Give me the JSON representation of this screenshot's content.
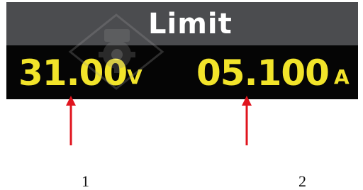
{
  "display": {
    "title": "Limit",
    "voltage": {
      "value": "31.00",
      "unit": "V"
    },
    "current": {
      "value": "05.100",
      "unit": "A"
    }
  },
  "callouts": [
    {
      "label": "1"
    },
    {
      "label": "2"
    }
  ],
  "colors": {
    "header_bg": "#4b4c4f",
    "readout_bg": "#050505",
    "readout_text": "#f2e42a",
    "title_text": "#ffffff",
    "arrow": "#e0141e"
  },
  "icons": {
    "watermark": "gear-camera-watermark-icon"
  }
}
